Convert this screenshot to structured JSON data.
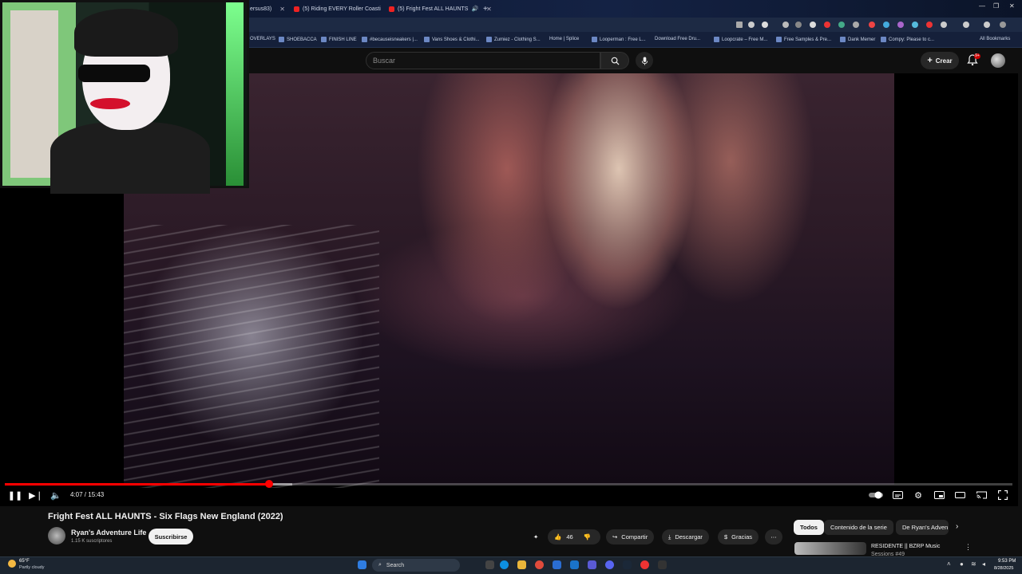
{
  "browser": {
    "tabs": [
      {
        "label": "ersus83)",
        "close": "✕"
      },
      {
        "label": "(5) Riding EVERY Roller Coasti",
        "close": "✕"
      },
      {
        "label": "(5) Fright Fest ALL HAUNTS",
        "close": "✕"
      }
    ],
    "new_tab": "+",
    "bookmarks": [
      "OVERLAYS",
      "SHOEBACCA",
      "FINISH LINE",
      "#becauseisneakers |...",
      "Vans Shoes & Clothi...",
      "Zumiez - Clothing S...",
      "Home | Splice",
      "Looperman : Free L...",
      "Download Free Dru...",
      "Loopcrate – Free M...",
      "Free Samples & Pre...",
      "Dank Memer",
      "Compy: Please to c..."
    ],
    "all_bookmarks": "All Bookmarks"
  },
  "youtube": {
    "search_placeholder": "Buscar",
    "create_label": "Crear",
    "notif_count": "9+"
  },
  "player": {
    "time": "4:07 / 15:43",
    "progress": 0.262,
    "buffered": 0.285
  },
  "video": {
    "title": "Fright Fest ALL HAUNTS - Six Flags New England (2022)",
    "channel": "Ryan's Adventure Life",
    "subscribers": "1.15 K suscriptores",
    "subscribe": "Suscribirse",
    "likes": "46",
    "share": "Compartir",
    "download": "Descargar",
    "thanks": "Gracias",
    "more": "⋯"
  },
  "chips": [
    "Todos",
    "Contenido de la serie",
    "De Ryan's Adven"
  ],
  "recommendation": {
    "title": "RESIDENTE || BZRP Music",
    "subtitle": "Sessions #49"
  },
  "taskbar": {
    "temp": "65°F",
    "weather": "Partly cloudy",
    "search": "Search",
    "time": "9:53 PM",
    "date": "8/28/2025"
  },
  "colors": {
    "accent": "#ff0000",
    "bg": "#0f0f0f",
    "chip_bg": "#272727"
  }
}
